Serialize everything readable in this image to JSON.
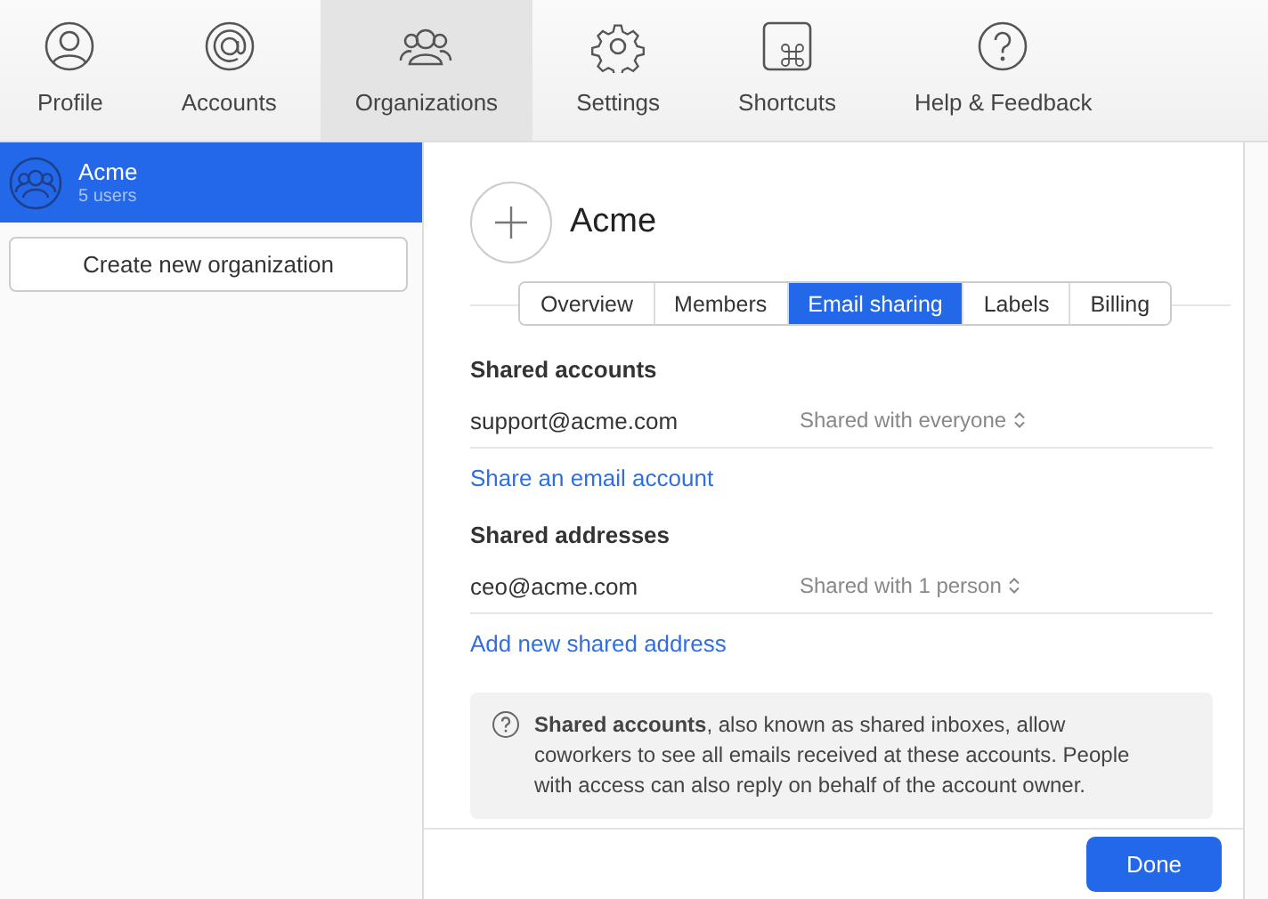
{
  "toolbar": [
    {
      "label": "Profile",
      "selected": false
    },
    {
      "label": "Accounts",
      "selected": false
    },
    {
      "label": "Organizations",
      "selected": true
    },
    {
      "label": "Settings",
      "selected": false
    },
    {
      "label": "Shortcuts",
      "selected": false
    },
    {
      "label": "Help & Feedback",
      "selected": false
    }
  ],
  "sidebar": {
    "items": [
      {
        "name": "Acme",
        "subtitle": "5 users",
        "selected": true
      }
    ],
    "create_button": "Create new organization"
  },
  "organization": {
    "name": "Acme"
  },
  "tabs": [
    {
      "label": "Overview",
      "selected": false
    },
    {
      "label": "Members",
      "selected": false
    },
    {
      "label": "Email sharing",
      "selected": true
    },
    {
      "label": "Labels",
      "selected": false
    },
    {
      "label": "Billing",
      "selected": false
    }
  ],
  "sections": [
    {
      "heading": "Shared accounts",
      "rows": [
        {
          "email": "support@acme.com",
          "sharing": "Shared with everyone"
        }
      ],
      "link": "Share an email account"
    },
    {
      "heading": "Shared addresses",
      "rows": [
        {
          "email": "ceo@acme.com",
          "sharing": "Shared with 1 person"
        }
      ],
      "link": "Add new shared address"
    }
  ],
  "info": "**Shared accounts**, also known as shared inboxes, allow coworkers to see all emails received at these accounts. People with access can also reply on behalf of the account owner.",
  "done_button": "Done"
}
